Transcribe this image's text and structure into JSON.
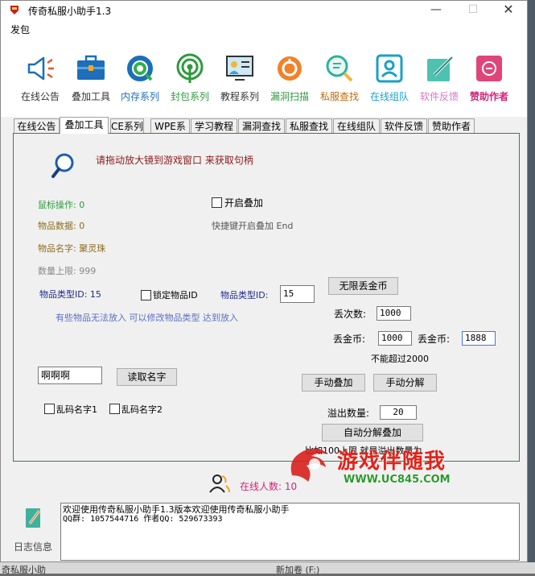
{
  "window": {
    "title": "传奇私服小助手1.3"
  },
  "menu": {
    "item": "发包"
  },
  "toolbar": [
    {
      "label": "在线公告",
      "color": "#333333",
      "icon": "megaphone-icon"
    },
    {
      "label": "叠加工具",
      "color": "#333333",
      "icon": "toolbox-icon"
    },
    {
      "label": "内存系列",
      "color": "#1c6fb8",
      "icon": "memory-icon"
    },
    {
      "label": "封包系列",
      "color": "#2d9a3c",
      "icon": "signal-icon"
    },
    {
      "label": "教程系列",
      "color": "#333333",
      "icon": "tutorial-icon"
    },
    {
      "label": "漏洞扫描",
      "color": "#2d9a3c",
      "icon": "scan-icon"
    },
    {
      "label": "私服查找",
      "color": "#c06a10",
      "icon": "find-icon"
    },
    {
      "label": "在线组队",
      "color": "#1aa0c8",
      "icon": "team-icon"
    },
    {
      "label": "软件反馈",
      "color": "#d27ac4",
      "icon": "feedback-icon"
    },
    {
      "label": "赞助作者",
      "color": "#d4237a",
      "icon": "sponsor-icon"
    }
  ],
  "tabs": [
    "在线公告",
    "叠加工具",
    "CE系列",
    "WPE系列",
    "学习教程",
    "漏洞查找",
    "私服查找",
    "在线组队",
    "软件反馈",
    "赞助作者"
  ],
  "panel": {
    "drag_hint": "请拖动放大镜到游戏窗口 来获取句柄",
    "mouse_op": "鼠标操作: 0",
    "item_data": "物品数据: 0",
    "item_name": "物品名字: 聚灵珠",
    "qty_limit": "数量上限: 999",
    "enable_stack": "开启叠加",
    "hotkey_hint": "快捷键开启叠加 End",
    "item_type_id_left": "物品类型ID: 15",
    "lock_item": "锁定物品ID",
    "item_type_id_label": "物品类型ID:",
    "item_type_id_value": "15",
    "hint_cannot_place": "有些物品无法放入 可以修改物品类型 达到放入",
    "infinite_drop_button": "无限丢金币",
    "drop_times_label": "丢次数:",
    "drop_times_value": "1000",
    "drop_gold_label": "丢金币:",
    "drop_gold_value": "1000",
    "drop_gold2_label": "丢金币:",
    "drop_gold2_value": "1888",
    "limit_note": "不能超过2000",
    "name_value": "啊啊啊",
    "read_name_button": "读取名字",
    "manual_stack_button": "手动叠加",
    "manual_split_button": "手动分解",
    "garble1": "乱码名字1",
    "garble2": "乱码名字2",
    "overflow_label": "溢出数量:",
    "overflow_value": "20",
    "auto_split_button": "自动分解叠加",
    "overflow_note": "比如100上限 就是溢出数量为"
  },
  "status": {
    "online": "在线人数: 10",
    "online_color": "#d4237a"
  },
  "log": {
    "label": "日志信息",
    "line1": "欢迎使用传奇私服小助手1.3版本欢迎使用传奇私服小助手",
    "line2": "QQ群: 1057544716   作者QQ: 529673393"
  },
  "watermark": {
    "line1": "游戏伴随我",
    "line2": "WWW.UC845.COM"
  },
  "desktop": {
    "left_text": "奇私服小助",
    "right_text": "新加卷 (F:)"
  }
}
